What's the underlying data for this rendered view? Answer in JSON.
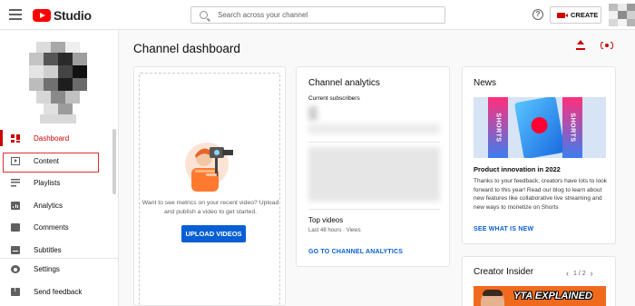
{
  "header": {
    "app_name": "Studio",
    "search_placeholder": "Search across your channel",
    "help_glyph": "?",
    "create_label": "CREATE"
  },
  "sidebar": {
    "items": [
      {
        "label": "Dashboard",
        "icon": "dashboard-icon",
        "active": true
      },
      {
        "label": "Content",
        "icon": "content-icon"
      },
      {
        "label": "Playlists",
        "icon": "playlists-icon"
      },
      {
        "label": "Analytics",
        "icon": "analytics-icon"
      },
      {
        "label": "Comments",
        "icon": "comments-icon"
      },
      {
        "label": "Subtitles",
        "icon": "subtitles-icon"
      }
    ],
    "footer": [
      {
        "label": "Settings",
        "icon": "gear-icon"
      },
      {
        "label": "Send feedback",
        "icon": "feedback-icon"
      }
    ]
  },
  "main": {
    "title": "Channel dashboard",
    "upload_card": {
      "text": "Want to see metrics on your recent video? Upload and publish a video to get started.",
      "button": "UPLOAD VIDEOS"
    },
    "analytics": {
      "title": "Channel analytics",
      "subscribers_label": "Current subscribers",
      "top_videos_title": "Top videos",
      "top_videos_sub": "Last 48 hours · Views",
      "link": "GO TO CHANNEL ANALYTICS"
    },
    "news": {
      "title": "News",
      "thumb_left": "SHORTS",
      "thumb_right": "SHORTS",
      "headline": "Product innovation in 2022",
      "body": "Thanks to your feedback, creators have lots to look forward to this year! Read our blog to learn about new features like collaborative live streaming and new ways to monetize on Shorts",
      "link": "SEE WHAT IS NEW"
    },
    "creator_insider": {
      "title": "Creator Insider",
      "prev": "‹",
      "page": "1 / 2",
      "next": "›",
      "thumb_text": "YTA EXPLAINED"
    }
  },
  "colors": {
    "brand_red": "#ff0000",
    "accent_red": "#cc0000",
    "link_blue": "#065fd4"
  }
}
